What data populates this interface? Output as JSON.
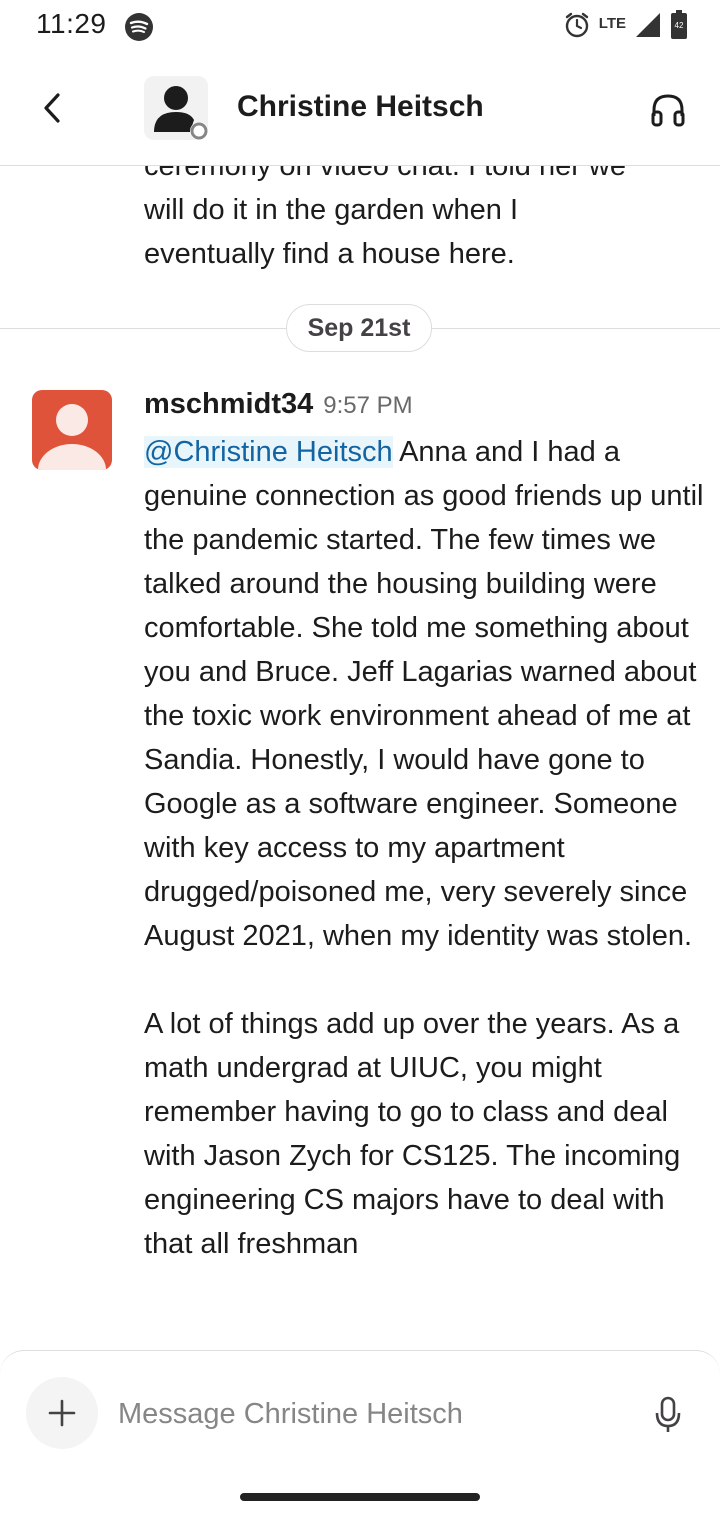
{
  "status_bar": {
    "time": "11:29",
    "network_label": "LTE",
    "battery_label": "42"
  },
  "header": {
    "title": "Christine Heitsch"
  },
  "conversation": {
    "previous_message_lines": [
      "ceremony on video chat. I told her we",
      "will do it in the garden when I",
      "eventually find a house here."
    ],
    "date_divider": "Sep 21st",
    "message": {
      "username": "mschmidt34",
      "time": "9:57 PM",
      "mention": "@Christine Heitsch",
      "paragraph_1": " Anna and I had a genuine connection as good friends up until the pandemic started. The few times we talked around the housing building were comfortable. She told me something about you and Bruce. Jeff Lagarias warned about the toxic work environment ahead of me at Sandia. Honestly, I would have gone to Google as a software engineer. Someone with key access to my apartment drugged/poisoned me, very severely since August 2021, when my identity was stolen.",
      "paragraph_2": "A lot of things add up over the years. As a math undergrad at UIUC, you might remember having to go to class and deal with Jason Zych for CS125. The incoming engineering CS majors have to deal with that all freshman"
    }
  },
  "composer": {
    "placeholder": "Message Christine Heitsch"
  },
  "colors": {
    "mention": "#1264a3",
    "mention_bg": "#e8f5fa",
    "avatar_user": "#e0533b",
    "divider": "#dddddd"
  },
  "icons": [
    "spotify-icon",
    "alarm-icon",
    "signal-icon",
    "battery-icon",
    "back-arrow-icon",
    "user-avatar-icon",
    "headphones-icon",
    "plus-icon",
    "microphone-icon"
  ]
}
